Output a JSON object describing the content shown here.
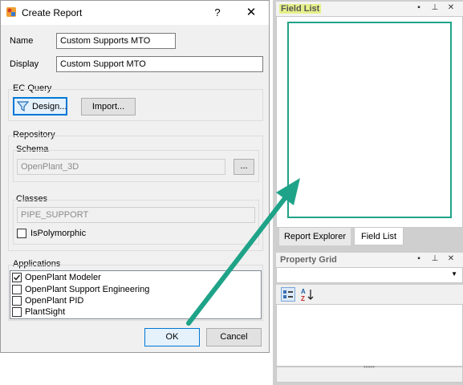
{
  "dialog": {
    "title": "Create Report",
    "help": "?",
    "close": "✕",
    "name_label": "Name",
    "name_value": "Custom Supports MTO",
    "display_label": "Display",
    "display_value": "Custom Support MTO",
    "ec_query": {
      "label": "EC Query",
      "design_button": "Design...",
      "import_button": "Import..."
    },
    "repository": {
      "label": "Repository",
      "schema_label": "Schema",
      "schema_value": "OpenPlant_3D",
      "browse_button": "...",
      "classes_label": "Classes",
      "classes_value": "PIPE_SUPPORT",
      "ispolymorphic_label": "IsPolymorphic",
      "ispolymorphic_checked": false
    },
    "applications": {
      "label": "Applications",
      "items": [
        {
          "label": "OpenPlant Modeler",
          "checked": true
        },
        {
          "label": "OpenPlant Support Engineering",
          "checked": false
        },
        {
          "label": "OpenPlant PID",
          "checked": false
        },
        {
          "label": "PlantSight",
          "checked": false
        }
      ]
    },
    "ok_button": "OK",
    "cancel_button": "Cancel"
  },
  "field_list_panel": {
    "title": "Field List",
    "tabs": [
      "Report Explorer",
      "Field List"
    ],
    "active_tab": "Field List"
  },
  "property_grid_panel": {
    "title": "Property Grid"
  },
  "colors": {
    "annotation_green": "#1fa388",
    "title_highlight": "#e6f08a",
    "selected_button_blue": "#0078d7"
  },
  "icons": {
    "filter": "filter-icon",
    "sort": "sort-az-icon",
    "categorized": "categorized-icon"
  }
}
